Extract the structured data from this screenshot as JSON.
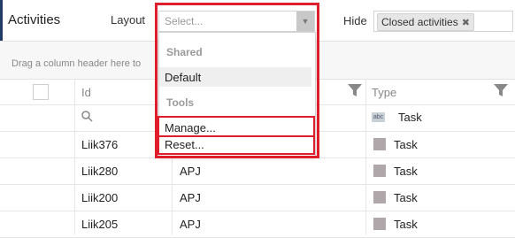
{
  "header": {
    "title": "Activities",
    "layout_label": "Layout",
    "layout_placeholder": "Select...",
    "hide_label": "Hide",
    "hide_tags": [
      "Closed activities"
    ]
  },
  "drag_hint": "Drag a column header here to",
  "grid": {
    "columns": [
      "Id",
      "Type"
    ],
    "type_filter_value": "Task",
    "rows": [
      {
        "id": "Liik376",
        "owner": "",
        "type": "Task"
      },
      {
        "id": "Liik280",
        "owner": "APJ",
        "type": "Task"
      },
      {
        "id": "Liik200",
        "owner": "APJ",
        "type": "Task"
      },
      {
        "id": "Liik205",
        "owner": "APJ",
        "type": "Task"
      }
    ]
  },
  "dropdown": {
    "groups": [
      {
        "label": "Shared",
        "items": [
          "Default"
        ]
      },
      {
        "label": "Tools",
        "items": [
          "Manage...",
          "Reset..."
        ]
      }
    ],
    "selected": "Default"
  },
  "colors": {
    "highlight": "#e01e2b",
    "task_square": "#b0a7ab",
    "accent": "#1f3b66"
  },
  "icons": [
    "filter-icon",
    "search-icon",
    "abc-icon",
    "close-icon",
    "chevron-down-icon"
  ]
}
